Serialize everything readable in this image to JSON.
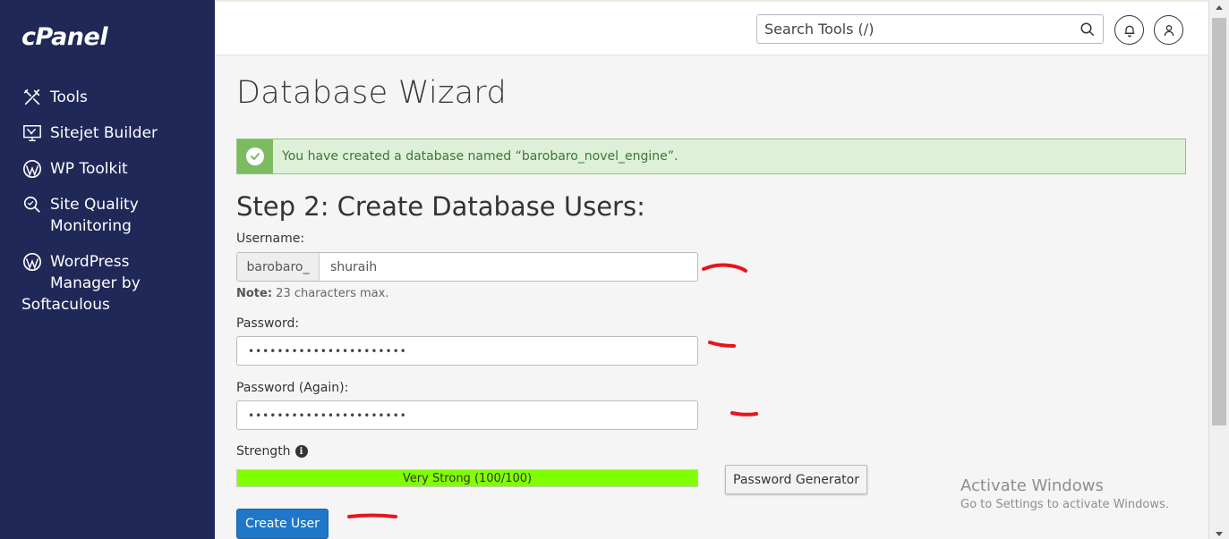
{
  "sidebar": {
    "logo": "cPanel",
    "items": [
      {
        "label": "Tools",
        "icon": "tools-icon"
      },
      {
        "label": "Sitejet Builder",
        "icon": "monitor-icon"
      },
      {
        "label": "WP Toolkit",
        "icon": "wordpress-icon"
      },
      {
        "label": "Site Quality\nMonitoring",
        "icon": "search-quality-icon"
      },
      {
        "label": "WordPress\nManager by",
        "icon": "wordpress-icon"
      }
    ],
    "extra_line": "Softaculous"
  },
  "topbar": {
    "search_placeholder": "Search Tools (/)"
  },
  "main": {
    "page_title": "Database Wizard",
    "alert_text": "You have created a database named “barobaro_novel_engine”.",
    "step_title": "Step 2: Create Database Users:",
    "username_label": "Username:",
    "username_prefix": "barobaro_",
    "username_value": "shuraih",
    "note_bold": "Note:",
    "note_text": " 23 characters max.",
    "password_label": "Password:",
    "password_value": "••••••••••••••••••••••",
    "password_again_label": "Password (Again):",
    "password_again_value": "••••••••••••••••••••••",
    "strength_label": "Strength",
    "strength_text": "Very Strong (100/100)",
    "strength_fraction": 1.0,
    "password_generator_label": "Password Generator",
    "create_user_label": "Create User"
  },
  "watermark": {
    "line1": "Activate Windows",
    "line2": "Go to Settings to activate Windows."
  },
  "colors": {
    "sidebar_bg": "#202858",
    "alert_bg": "#dff0d8",
    "meter_fill": "#7fff00",
    "primary_button": "#1f77c9",
    "annotation_red": "#e8141c"
  }
}
